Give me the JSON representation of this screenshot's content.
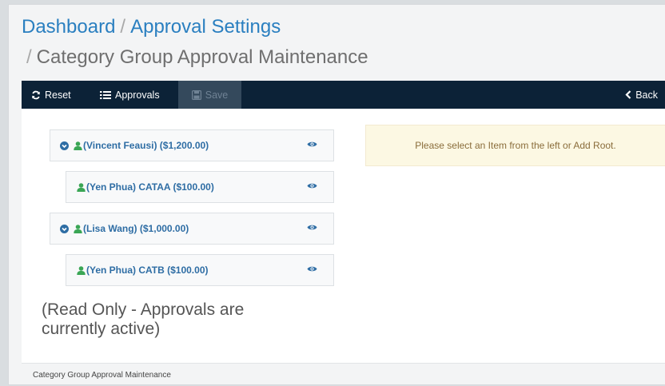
{
  "breadcrumb": {
    "items": [
      "Dashboard",
      "Approval Settings"
    ],
    "separator": "/",
    "current": "Category Group Approval Maintenance"
  },
  "toolbar": {
    "reset_label": "Reset",
    "approvals_label": "Approvals",
    "save_label": "Save",
    "back_label": "Back"
  },
  "tree": [
    {
      "label": "(Vincent Feausi) ($1,200.00)",
      "level": 0,
      "expandable": true,
      "icons": [
        "expand-circle-icon",
        "user-icon",
        "eye-icon"
      ]
    },
    {
      "label": "(Yen Phua) CATAA ($100.00)",
      "level": 1,
      "expandable": false,
      "icons": [
        "user-icon",
        "eye-icon"
      ]
    },
    {
      "label": "(Lisa Wang) ($1,000.00)",
      "level": 0,
      "expandable": true,
      "icons": [
        "expand-circle-icon",
        "user-icon",
        "eye-icon"
      ]
    },
    {
      "label": "(Yen Phua) CATB ($100.00)",
      "level": 1,
      "expandable": false,
      "icons": [
        "user-icon",
        "eye-icon"
      ]
    }
  ],
  "readonly_notice": "(Read Only - Approvals are currently active)",
  "info_message": "Please select an Item from the left or Add Root.",
  "footer_text": "Category Group Approval Maintenance",
  "colors": {
    "link": "#2a7fc0",
    "toolbar_bg": "#0c2237",
    "user_icon": "#3aa655",
    "notice_bg": "#fcf8e3",
    "notice_text": "#8a6d3b"
  }
}
